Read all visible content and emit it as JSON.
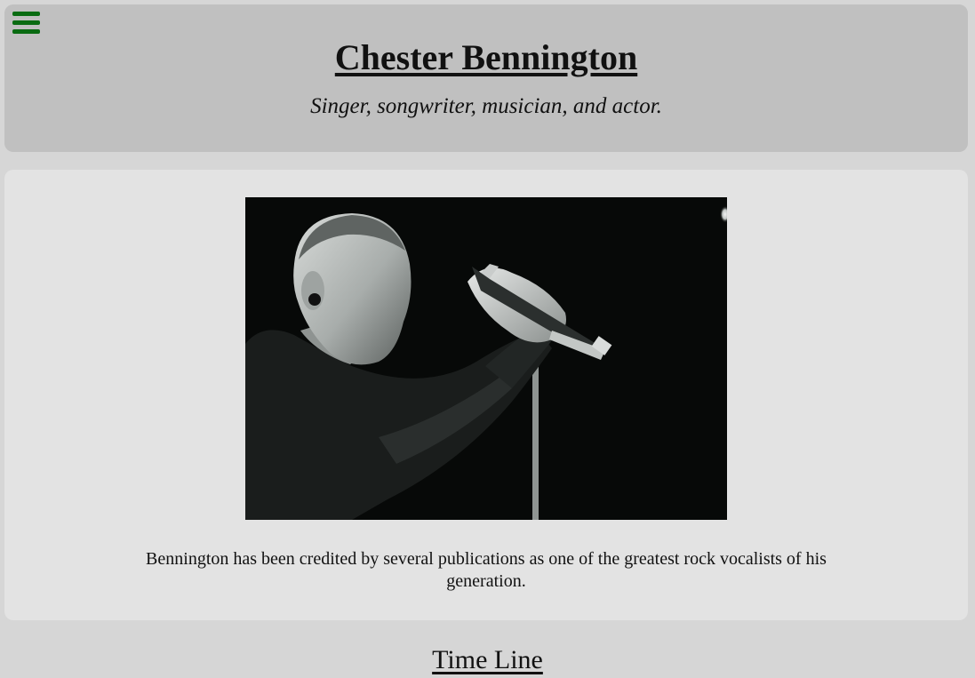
{
  "menu": {
    "icon": "hamburger-menu-icon",
    "color": "#0a6b12"
  },
  "header": {
    "title": "Chester Bennington",
    "subtitle": "Singer, songwriter, musician, and actor."
  },
  "main": {
    "image_icon": "singer-photo",
    "caption": "Bennington has been credited by several publications as one of the greatest rock vocalists of his generation."
  },
  "timeline": {
    "heading": "Time Line"
  },
  "colors": {
    "page_background": "#d6d6d6",
    "header_background": "#c0c0c0",
    "card_background": "#e3e3e3"
  }
}
